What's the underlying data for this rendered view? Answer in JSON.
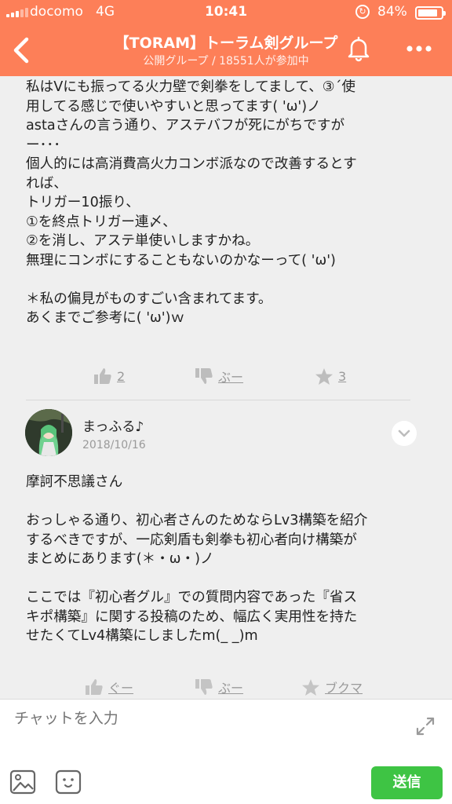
{
  "status_bar": {
    "carrier": "docomo",
    "network": "4G",
    "time": "10:41",
    "battery_percent": "84%",
    "battery_level": 0.84
  },
  "nav": {
    "title": "【TORAM】トーラム剣グループ",
    "subtitle": "公開グループ / 18551人が参加中",
    "icons": [
      "chevron-left-icon",
      "bell-icon",
      "more-icon"
    ]
  },
  "posts": [
    {
      "body": "私はVにも振ってる火力壁で剣拳をしてまして、③´使\n用してる感じで使いやすいと思ってます( 'ω')ノ\nastaさんの言う通り、アステバフが死にがちですが\nー･･･\n個人的には高消費高火力コンボ派なので改善するとす\nれば、\nトリガー10振り、\n①を終点トリガー連〆、\n②を消し、アステ単使いしますかね。\n無理にコンボにすることもないのかなーって( 'ω')\n\n＊私の偏見がものすごい含まれてます。\nあくまでご参考に( 'ω')ｗ",
      "actions": {
        "like": "2",
        "dislike": "ぶー",
        "star": "3"
      }
    },
    {
      "author": "まっふる♪",
      "date": "2018/10/16",
      "body": "摩訶不思議さん\n\nおっしゃる通り、初心者さんのためならLv3構築を紹介\nするべきですが、一応剣盾も剣拳も初心者向け構築が\nまとめにあります(＊・ω・)ノ\n\nここでは『初心者グル』での質問内容であった『省ス\nキポ構築』に関する投稿のため、幅広く実用性を持た\nせたくてLv4構築にしましたm(_ _)m",
      "actions": {
        "like": "ぐー",
        "dislike": "ぶー",
        "star": "ブクマ"
      }
    }
  ],
  "composer": {
    "placeholder": "チャットを入力",
    "send_label": "送信"
  },
  "colors": {
    "header": "#fd7f58",
    "send": "#3ec444",
    "background": "#efefef"
  }
}
